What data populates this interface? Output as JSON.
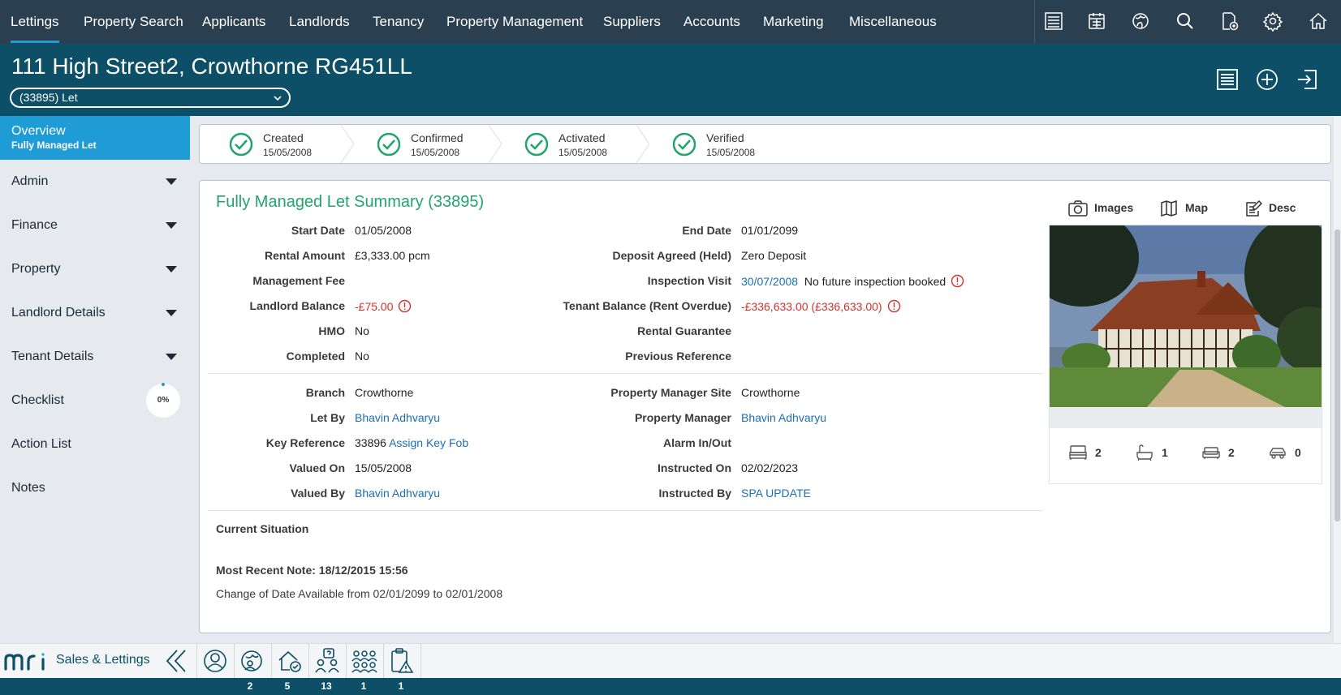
{
  "nav": {
    "items": [
      "Lettings",
      "Property Search",
      "Applicants",
      "Landlords",
      "Tenancy",
      "Property Management",
      "Suppliers",
      "Accounts",
      "Marketing",
      "Miscellaneous"
    ],
    "active": "Lettings",
    "icons": [
      "list-icon",
      "calendar-icon",
      "globe-icon",
      "search-icon",
      "document-add-icon",
      "gear-icon",
      "home-icon"
    ]
  },
  "header": {
    "title": "111 High Street2, Crowthorne RG451LL",
    "status_select": "(33895) Let",
    "icons": [
      "list-icon",
      "add-circle-icon",
      "exit-icon"
    ]
  },
  "sidebar": {
    "overview": {
      "label": "Overview",
      "sub": "Fully Managed Let"
    },
    "items": [
      "Admin",
      "Finance",
      "Property",
      "Landlord Details",
      "Tenant Details",
      "Checklist",
      "Action List",
      "Notes"
    ],
    "checklist_progress": "0%"
  },
  "steps": [
    {
      "label": "Created",
      "date": "15/05/2008"
    },
    {
      "label": "Confirmed",
      "date": "15/05/2008"
    },
    {
      "label": "Activated",
      "date": "15/05/2008"
    },
    {
      "label": "Verified",
      "date": "15/05/2008"
    }
  ],
  "summary": {
    "title": "Fully Managed Let Summary (33895)",
    "left_fields": [
      {
        "label": "Start Date",
        "value": "01/05/2008"
      },
      {
        "label": "Rental Amount",
        "value": "£3,333.00 pcm"
      },
      {
        "label": "Management Fee",
        "value": ""
      },
      {
        "label": "Landlord Balance",
        "value": "-£75.00"
      },
      {
        "label": "HMO",
        "value": "No"
      },
      {
        "label": "Completed",
        "value": "No"
      }
    ],
    "right_fields": [
      {
        "label": "End Date",
        "value": "01/01/2099"
      },
      {
        "label": "Deposit Agreed (Held)",
        "value": "Zero Deposit"
      },
      {
        "label": "Inspection Visit",
        "value": "30/07/2008",
        "note": "No future inspection booked"
      },
      {
        "label": "Tenant Balance (Rent Overdue)",
        "value": "-£336,633.00 (£336,633.00)"
      },
      {
        "label": "Rental Guarantee",
        "value": ""
      },
      {
        "label": "Previous Reference",
        "value": ""
      }
    ],
    "left_fields_2": [
      {
        "label": "Branch",
        "value": "Crowthorne"
      },
      {
        "label": "Let By",
        "value": "Bhavin Adhvaryu"
      },
      {
        "label": "Key Reference",
        "value": "33896",
        "link": "Assign Key Fob"
      },
      {
        "label": "Valued On",
        "value": "15/05/2008"
      },
      {
        "label": "Valued By",
        "value": "Bhavin Adhvaryu"
      }
    ],
    "right_fields_2": [
      {
        "label": "Property Manager Site",
        "value": "Crowthorne"
      },
      {
        "label": "Property Manager",
        "value": "Bhavin Adhvaryu"
      },
      {
        "label": "Alarm In/Out",
        "value": ""
      },
      {
        "label": "Instructed On",
        "value": "02/02/2023"
      },
      {
        "label": "Instructed By",
        "value": "SPA UPDATE"
      }
    ],
    "current_situation": "Current Situation",
    "recent_note_heading": "Most Recent Note: 18/12/2015 15:56",
    "recent_note_text": "Change of Date Available from 02/01/2099 to 02/01/2008"
  },
  "media": {
    "tabs": [
      "Images",
      "Map",
      "Desc"
    ],
    "active_tab": "Images",
    "features": {
      "bedrooms": "2",
      "bathrooms": "1",
      "receptions": "2",
      "parking": "0"
    }
  },
  "bottom": {
    "brand": "Sales & Lettings",
    "counts": [
      "2",
      "5",
      "13",
      "1",
      "1"
    ]
  },
  "colors": {
    "nav_bg": "#2a3f4f",
    "header_bg": "#0c4f67",
    "accent": "#1f9bd6",
    "title_green": "#23a36f",
    "negative": "#d0322b",
    "link": "#1a6fb5"
  }
}
